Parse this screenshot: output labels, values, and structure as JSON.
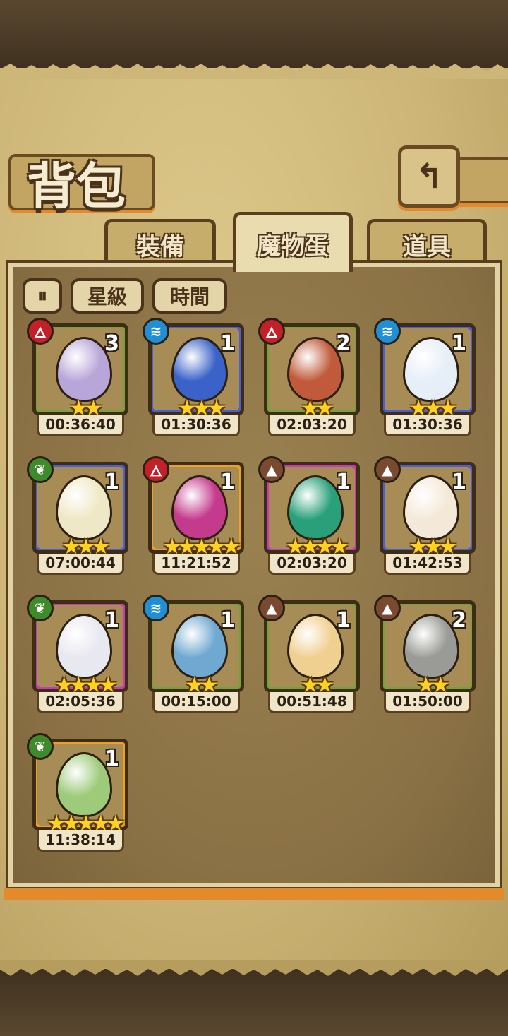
{
  "header": {
    "title": "背包",
    "back_icon": "↰"
  },
  "tabs": [
    {
      "label": "裝備",
      "active": false
    },
    {
      "label": "魔物蛋",
      "active": true
    },
    {
      "label": "道具",
      "active": false
    }
  ],
  "filters": {
    "toggle_icon": "⏸",
    "sort_stars_label": "星級",
    "sort_time_label": "時間"
  },
  "element_icons": {
    "fire": "🜂",
    "water": "≋",
    "earth": "▲",
    "wood": "❦"
  },
  "colors": {
    "fire": "#c4202a",
    "water": "#1f8fd6",
    "earth": "#7a4a30",
    "wood": "#3f8a2a",
    "frame_green": "#74a33a",
    "frame_blue": "#4a5ed8",
    "frame_gold": "#f0a020",
    "frame_pink": "#c83ab8"
  },
  "eggs": [
    {
      "element": "fire",
      "count": "3",
      "stars": "★★",
      "timer": "00:36:40",
      "frame": "green",
      "egg_color": "#b8a6d8"
    },
    {
      "element": "water",
      "count": "1",
      "stars": "★★★",
      "timer": "01:30:36",
      "frame": "blue",
      "egg_color": "#3a62c8"
    },
    {
      "element": "fire",
      "count": "2",
      "stars": "★★",
      "timer": "02:03:20",
      "frame": "green",
      "egg_color": "#c05a3a"
    },
    {
      "element": "water",
      "count": "1",
      "stars": "★★★",
      "timer": "01:30:36",
      "frame": "blue",
      "egg_color": "#e6eef7"
    },
    {
      "element": "wood",
      "count": "1",
      "stars": "★★★",
      "timer": "07:00:44",
      "frame": "blue",
      "egg_color": "#efe8c6"
    },
    {
      "element": "fire",
      "count": "1",
      "stars": "★★★★★",
      "timer": "11:21:52",
      "frame": "gold",
      "egg_color": "#c43a8c"
    },
    {
      "element": "earth",
      "count": "1",
      "stars": "★★★★",
      "timer": "02:03:20",
      "frame": "pink",
      "egg_color": "#2aa07a"
    },
    {
      "element": "earth",
      "count": "1",
      "stars": "★★★",
      "timer": "01:42:53",
      "frame": "blue",
      "egg_color": "#f4e9d8"
    },
    {
      "element": "wood",
      "count": "1",
      "stars": "★★★★",
      "timer": "02:05:36",
      "frame": "pink",
      "egg_color": "#e8e8f0"
    },
    {
      "element": "water",
      "count": "1",
      "stars": "★★",
      "timer": "00:15:00",
      "frame": "green",
      "egg_color": "#6fa8d0"
    },
    {
      "element": "earth",
      "count": "1",
      "stars": "★★",
      "timer": "00:51:48",
      "frame": "green",
      "egg_color": "#f0d090"
    },
    {
      "element": "earth",
      "count": "2",
      "stars": "★★",
      "timer": "01:50:00",
      "frame": "green",
      "egg_color": "#9a9a96"
    },
    {
      "element": "wood",
      "count": "1",
      "stars": "★★★★★",
      "timer": "11:38:14",
      "frame": "gold",
      "egg_color": "#9ecb7a"
    }
  ]
}
